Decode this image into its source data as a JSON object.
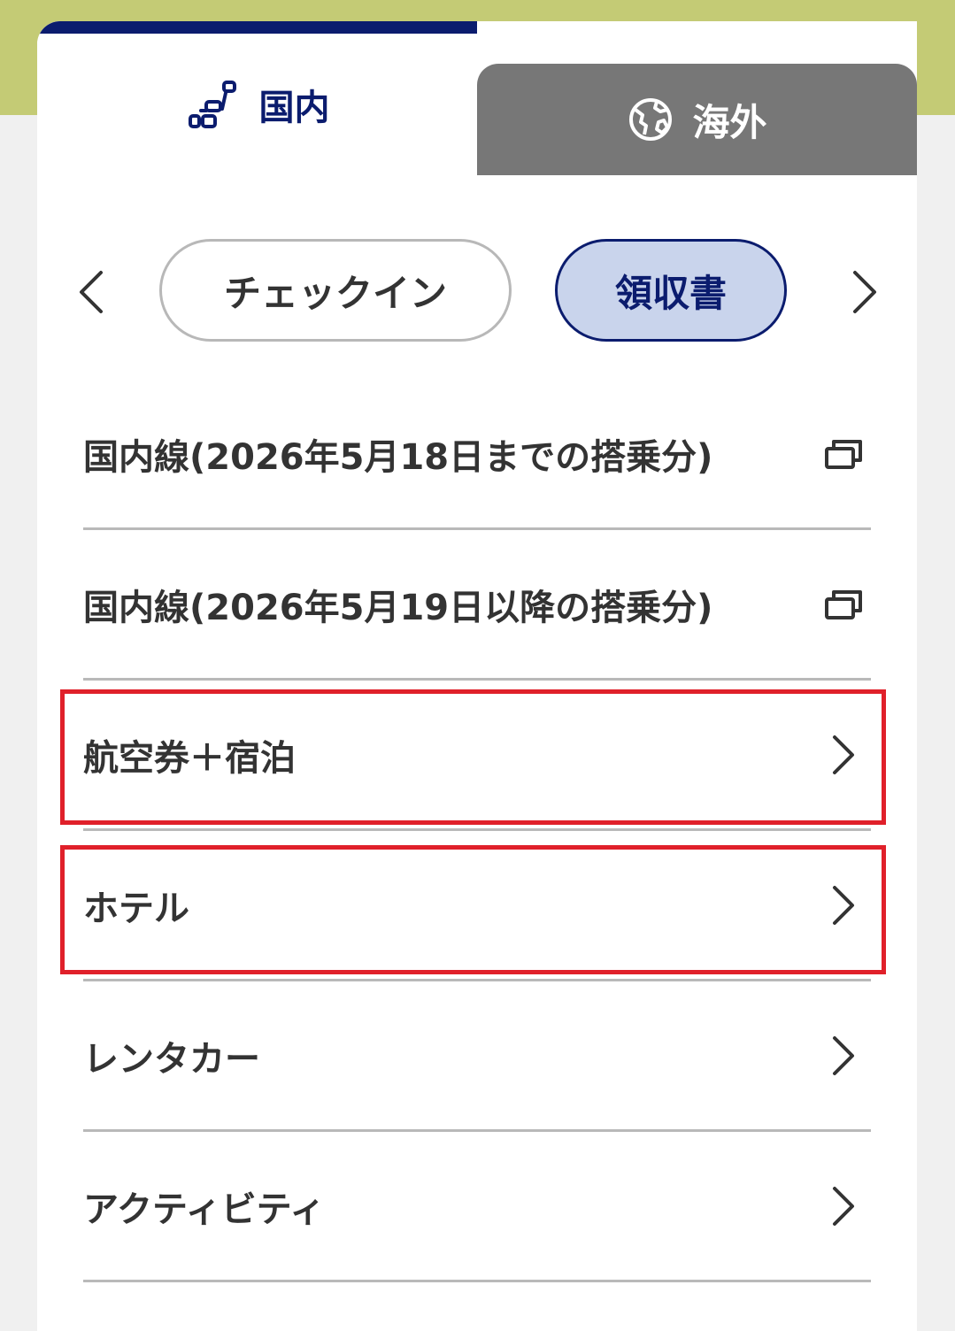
{
  "tabs": {
    "domestic": {
      "label": "国内",
      "icon": "domestic-flight-seat-icon"
    },
    "international": {
      "label": "海外",
      "icon": "globe-icon"
    }
  },
  "pills": {
    "prev_icon": "chevron-left-icon",
    "items": [
      {
        "label": "チェックイン",
        "active": false
      },
      {
        "label": "領収書",
        "active": true
      }
    ],
    "next_icon": "chevron-right-icon"
  },
  "menu": [
    {
      "label": "国内線(2026年5月18日までの搭乗分)",
      "icon": "external-window-icon"
    },
    {
      "label": "国内線(2026年5月19日以降の搭乗分)",
      "icon": "external-window-icon"
    },
    {
      "label": "航空券＋宿泊",
      "icon": "chevron-right-icon",
      "highlighted": true
    },
    {
      "label": "ホテル",
      "icon": "chevron-right-icon",
      "highlighted": true
    },
    {
      "label": "レンタカー",
      "icon": "chevron-right-icon"
    },
    {
      "label": "アクティビティ",
      "icon": "chevron-right-icon"
    }
  ],
  "colors": {
    "brand_navy": "#0b1c6e",
    "header_band": "#c4cb75",
    "active_pill_bg": "#c9d4ec",
    "highlight_box": "#e0202a",
    "inactive_tab": "#777777"
  }
}
